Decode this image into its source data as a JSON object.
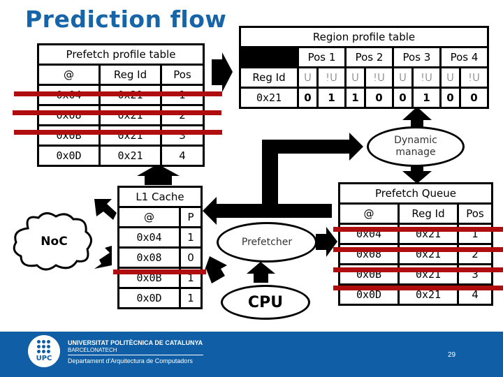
{
  "title": "Prediction flow",
  "prefetch_profile_table": {
    "caption": "Prefetch profile table",
    "headers": [
      "@",
      "Reg Id",
      "Pos"
    ],
    "rows": [
      {
        "addr": "0x04",
        "reg": "0x21",
        "pos": "1",
        "struck": true
      },
      {
        "addr": "0x08",
        "reg": "0x21",
        "pos": "2",
        "struck": true
      },
      {
        "addr": "0x0B",
        "reg": "0x21",
        "pos": "3",
        "struck": true
      },
      {
        "addr": "0x0D",
        "reg": "0x21",
        "pos": "4",
        "struck": false
      }
    ]
  },
  "region_profile_table": {
    "caption": "Region profile table",
    "pos_headers": [
      "Pos 1",
      "Pos 2",
      "Pos 3",
      "Pos 4"
    ],
    "row_header_label": "Reg Id",
    "sub_headers": [
      "U",
      "!U",
      "U",
      "!U",
      "U",
      "!U",
      "U",
      "!U"
    ],
    "reg_id": "0x21",
    "values": [
      "0",
      "1",
      "1",
      "0",
      "0",
      "1",
      "0",
      "0"
    ]
  },
  "dynamic_manage": {
    "line1": "Dynamic",
    "line2": "manage"
  },
  "prefetch_queue": {
    "caption": "Prefetch Queue",
    "headers": [
      "@",
      "Reg Id",
      "Pos"
    ],
    "rows": [
      {
        "addr": "0x04",
        "reg": "0x21",
        "pos": "1",
        "struck": true
      },
      {
        "addr": "0x08",
        "reg": "0x21",
        "pos": "2",
        "struck": true
      },
      {
        "addr": "0x0B",
        "reg": "0x21",
        "pos": "3",
        "struck": true
      },
      {
        "addr": "0x0D",
        "reg": "0x21",
        "pos": "4",
        "struck": true
      }
    ]
  },
  "l1_cache": {
    "caption": "L1 Cache",
    "headers": [
      "@",
      "P"
    ],
    "rows": [
      {
        "addr": "0x04",
        "p": "1",
        "struck": false
      },
      {
        "addr": "0x08",
        "p": "0",
        "struck": false
      },
      {
        "addr": "0x0B",
        "p": "1",
        "struck": true
      },
      {
        "addr": "0x0D",
        "p": "1",
        "struck": false
      }
    ]
  },
  "noc_label": "NoC",
  "prefetcher_label": "Prefetcher",
  "cpu_label": "CPU",
  "footer": {
    "logo_text": "UPC",
    "university": "UNIVERSITAT POLITÈCNICA DE CATALUNYA",
    "subtitle": "BARCELONATECH",
    "department": "Departament d'Arquitectura de Computadors",
    "page_number": "29",
    "background_color": "#0f5ea6"
  },
  "colors": {
    "title": "#1565a8",
    "strike": "#b00e0e"
  }
}
